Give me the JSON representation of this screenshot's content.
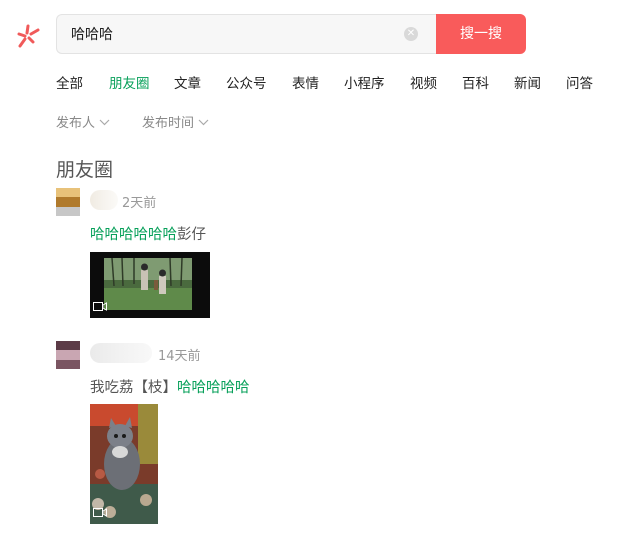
{
  "search": {
    "query": "哈哈哈",
    "button_label": "搜一搜"
  },
  "tabs": [
    {
      "label": "全部"
    },
    {
      "label": "朋友圈",
      "active": true
    },
    {
      "label": "文章"
    },
    {
      "label": "公众号"
    },
    {
      "label": "表情"
    },
    {
      "label": "小程序"
    },
    {
      "label": "视频"
    },
    {
      "label": "百科"
    },
    {
      "label": "新闻"
    },
    {
      "label": "问答"
    }
  ],
  "filters": [
    {
      "label": "发布人"
    },
    {
      "label": "发布时间"
    }
  ],
  "section_title": "朋友圈",
  "posts": [
    {
      "time": "2天前",
      "text_highlight": "哈哈哈哈哈哈",
      "text_rest": "彭仔",
      "media": "video"
    },
    {
      "time": "14天前",
      "text_plain": "我吃荔【枝】",
      "text_highlight": "哈哈哈哈哈",
      "media": "video"
    }
  ],
  "colors": {
    "accent_green": "#07a05a",
    "search_button": "#f95b5b",
    "logo": "#f05a5a"
  }
}
